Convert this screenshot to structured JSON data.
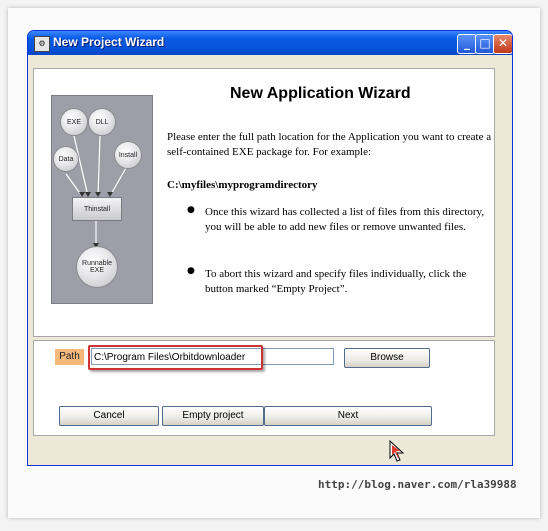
{
  "window": {
    "title": "New Project Wizard",
    "icon": "app-icon",
    "controls": {
      "minimize": "minimize-icon",
      "maximize": "maximize-icon",
      "close": "close-icon"
    }
  },
  "illustration": {
    "nodes": {
      "exe": "EXE",
      "dll": "DLL",
      "data": "Data",
      "install": "Install",
      "thinstall": "Thinstall",
      "runnable": [
        "Runnable",
        "EXE"
      ]
    }
  },
  "wizard": {
    "heading": "New Application Wizard",
    "intro": "Please enter the full path location for the Application you want to create a self-contained EXE package for.  For example:",
    "example": "C:\\myfiles\\myprogramdirectory",
    "bullets": [
      "Once this wizard has collected a list of files from this directory, you will be able to add new files or remove unwanted files.",
      "To abort this wizard and specify files individually, click the button marked “Empty Project”."
    ]
  },
  "form": {
    "path_label": "Path",
    "path_value": "C:\\Program Files\\Orbitdownloader",
    "browse_label": "Browse"
  },
  "buttons": {
    "cancel": "Cancel",
    "empty_project": "Empty project",
    "next": "Next"
  },
  "watermark": "http://blog.naver.com/rla39988"
}
